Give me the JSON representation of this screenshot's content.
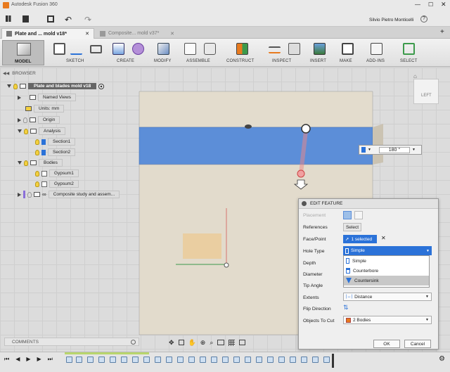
{
  "app": {
    "title": "Autodesk Fusion 360",
    "user": "Silvio Pietro Monticelli"
  },
  "tabs": [
    {
      "label": "Plate and ... mold v18*"
    },
    {
      "label": "Composite... mold v37*"
    }
  ],
  "ribbon": {
    "workspace": "MODEL",
    "groups": {
      "sketch": "SKETCH",
      "create": "CREATE",
      "modify": "MODIFY",
      "assemble": "ASSEMBLE",
      "construct": "CONSTRUCT",
      "inspect": "INSPECT",
      "insert": "INSERT",
      "make": "MAKE",
      "addins": "ADD-INS",
      "select": "SELECT"
    }
  },
  "browser": {
    "title": "BROWSER",
    "root": "Plate and blades mold v18",
    "items": [
      {
        "label": "Named Views"
      },
      {
        "label": "Units: mm"
      },
      {
        "label": "Origin"
      },
      {
        "label": "Analysis"
      },
      {
        "label": "Section1"
      },
      {
        "label": "Section2"
      },
      {
        "label": "Bodies"
      },
      {
        "label": "Gypsum1"
      },
      {
        "label": "Gypsum2"
      },
      {
        "label": "Composite study and assem..."
      }
    ]
  },
  "viewcube": {
    "face": "LEFT"
  },
  "angle_input": {
    "value": "180 °"
  },
  "comments": {
    "label": "COMMENTS"
  },
  "edit_feature": {
    "title": "EDIT FEATURE",
    "placement_label": "Placement",
    "references_label": "References",
    "references_value": "Select",
    "face_point_label": "Face/Point",
    "face_point_value": "1 selected",
    "hole_type_label": "Hole Type",
    "hole_type_value": "Simple",
    "hole_type_options": [
      "Simple",
      "Counterbore",
      "Countersink"
    ],
    "depth_label": "Depth",
    "diameter_label": "Diameter",
    "tip_angle_label": "Tip Angle",
    "extents_label": "Extents",
    "extents_value": "Distance",
    "flip_label": "Flip Direction",
    "objects_label": "Objects To Cut",
    "objects_value": "2 Bodies",
    "ok": "OK",
    "cancel": "Cancel"
  },
  "colors": {
    "accent": "#2b72d8",
    "selected_face": "#5c8ed8",
    "body": "#e0d8c8",
    "highlight_row": "#c8c8c8"
  }
}
